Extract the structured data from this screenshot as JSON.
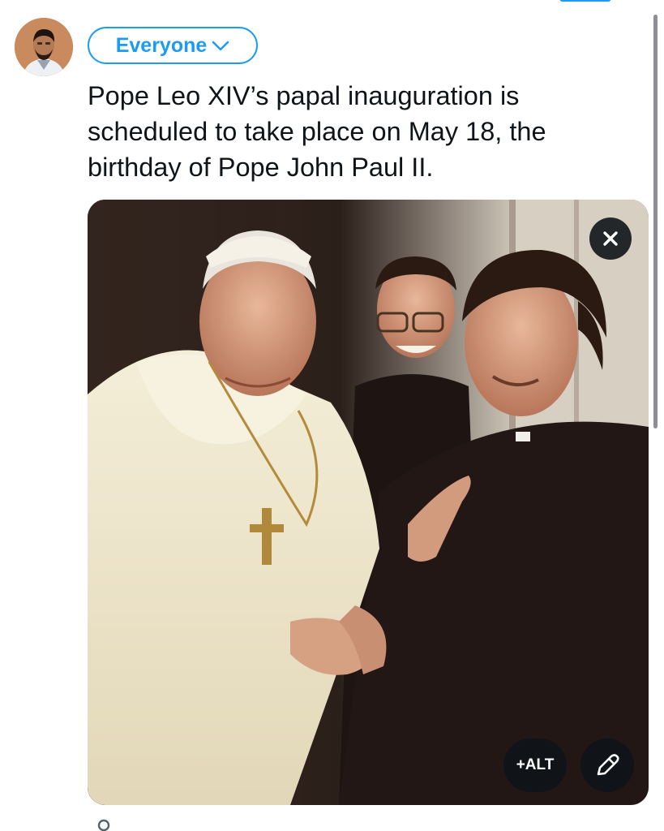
{
  "composer": {
    "audience_label": "Everyone",
    "audience_icon": "chevron-down-icon",
    "post_text": "Pope Leo XIV’s papal inauguration is\nscheduled to take place on May 18, the\nbirthday of Pope John Paul II."
  },
  "media": {
    "remove_icon": "close-icon",
    "alt_label": "+ALT",
    "edit_icon": "pencil-icon"
  },
  "colors": {
    "accent": "#1d9bf0",
    "text": "#0f1419",
    "overlay": "#0f1419"
  }
}
